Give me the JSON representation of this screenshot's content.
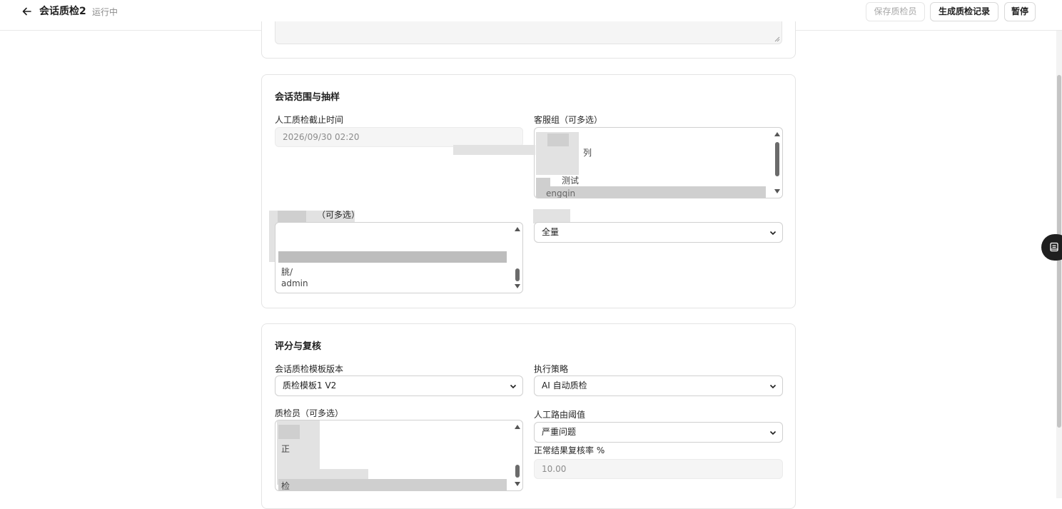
{
  "header": {
    "title": "会话质检2",
    "status": "运行中",
    "save_label": "保存质检员",
    "generate_label": "生成质检记录",
    "pause_label": "暂停"
  },
  "scope_section": {
    "title": "会话范围与抽样",
    "deadline_label": "人工质检截止时间",
    "deadline_value": "2026/09/30 02:20",
    "groups_label": "客服组（可多选）",
    "groups_options": [
      "列",
      "测试",
      "engqin"
    ],
    "agents_label_partial": "（可多选）",
    "agents_options": [
      "朓/",
      "admin"
    ],
    "sampling_value": "全量"
  },
  "score_section": {
    "title": "评分与复核",
    "template_label": "会话质检模板版本",
    "template_value": "质检模板1 V2",
    "strategy_label": "执行策略",
    "strategy_value": "AI 自动质检",
    "inspectors_label_partial": "质检员（可多选）",
    "inspectors_options": [
      "正",
      "检"
    ],
    "routing_label": "人工路由阈值",
    "routing_value": "严重问题",
    "review_rate_label": "正常结果复核率 %",
    "review_rate_value": "10.00"
  },
  "icons": {
    "back": "arrow-left-icon",
    "chevron": "chevron-down-icon",
    "float": "book-icon"
  },
  "colors": {
    "accent": "#1f1f1f",
    "muted": "#8c8c8c"
  }
}
